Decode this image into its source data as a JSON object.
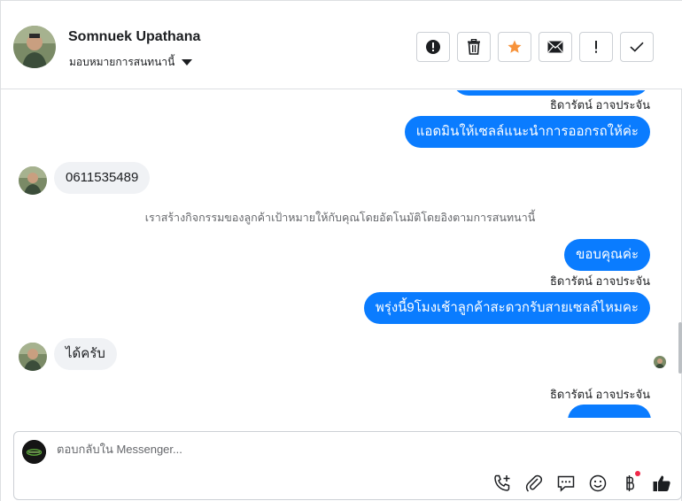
{
  "header": {
    "contact_name": "Somnuek Upathana",
    "assign_label": "มอบหมายการสนทนานี้",
    "actions": [
      {
        "name": "report-spam",
        "glyph": "!"
      },
      {
        "name": "delete",
        "glyph": "🗑"
      },
      {
        "name": "star",
        "glyph": "★"
      },
      {
        "name": "mark-unread",
        "glyph": "✉"
      },
      {
        "name": "follow-up",
        "glyph": "!"
      },
      {
        "name": "mark-done",
        "glyph": "✓"
      }
    ]
  },
  "colors": {
    "outgoing_bubble": "#0a7cff",
    "incoming_bubble": "#f0f2f5",
    "star": "#f7923a",
    "notification_dot": "#f02849"
  },
  "messages": {
    "m1_sender": "ธิดารัตน์ อาจประจัน",
    "m1_text": "แอดมินให้เซลล์แนะนำการออกรถให้ค่ะ",
    "m2_text": "0611535489",
    "system_note": "เราสร้างกิจกรรมของลูกค้าเป้าหมายให้กับคุณโดยอัตโนมัติโดยอิงตามการสนทนานี้",
    "m3_text": "ขอบคุณค่ะ",
    "m4_sender": "ธิดารัตน์ อาจประจัน",
    "m4_text": "พรุ่งนี้9โมงเช้าลูกค้าสะดวกรับสายเซลล์ไหมคะ",
    "m5_text": "ได้ครับ",
    "m6_sender": "ธิดารัตน์ อาจประจัน"
  },
  "composer": {
    "placeholder": "ตอบกลับใน Messenger..."
  },
  "tools": [
    "call-add-icon",
    "attachment-icon",
    "saved-reply-icon",
    "emoji-icon",
    "payment-icon",
    "like-icon"
  ]
}
